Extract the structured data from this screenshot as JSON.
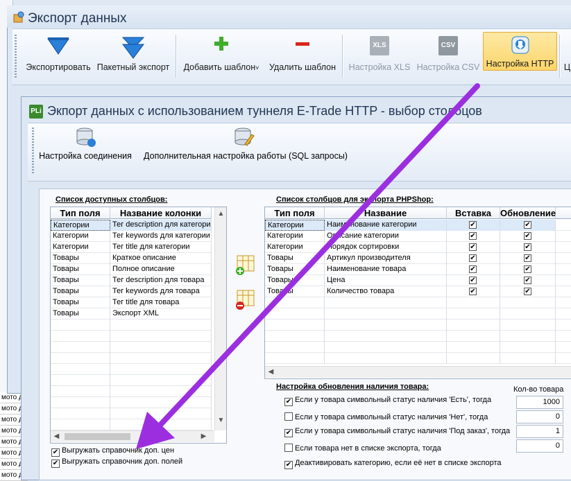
{
  "outer_window": {
    "title": "Экспорт данных"
  },
  "toolbar": {
    "export_label": "Экспортировать",
    "batch_export_label": "Пакетный экспорт",
    "add_template_label": "Добавить шаблон",
    "add_template_arrow": "˅",
    "delete_template_label": "Удалить шаблон",
    "xls_settings_label": "Настройка XLS",
    "xls_icon_text": "XLS",
    "csv_settings_label": "Настройка CSV",
    "csv_icon_text": "CSV",
    "http_settings_label": "Настройка HTTP",
    "cut_label": "Ц"
  },
  "background": {
    "moto_rows": [
      "мото д",
      "мото д",
      "мото д",
      "мото д",
      "мото д",
      "мото д",
      "мото д",
      "мото д"
    ]
  },
  "dialog": {
    "title": "Экпорт данных с использованием туннеля E-Trade HTTP - выбор столбцов",
    "icon_text": "PLi",
    "connection_settings_label": "Настройка соединения",
    "extra_settings_label": "Дополнительная настройка работы (SQL запросы)"
  },
  "available": {
    "caption": "Список доступных столбцов:",
    "headers": [
      "Тип поля",
      "Название колонки"
    ],
    "rows": [
      [
        "Категории",
        "Тег description для категории"
      ],
      [
        "Категории",
        "Тег keywords для категории"
      ],
      [
        "Категории",
        "Тег title для категории"
      ],
      [
        "Товары",
        "Краткое описание"
      ],
      [
        "Товары",
        "Полное описание"
      ],
      [
        "Товары",
        "Тег description для товара"
      ],
      [
        "Товары",
        "Тег keywords для товара"
      ],
      [
        "Товары",
        "Тег title для товара"
      ],
      [
        "Товары",
        "Экспорт XML"
      ]
    ]
  },
  "export_cols": {
    "caption": "Список столбцов для экспорта PHPShop:",
    "headers": [
      "Тип поля",
      "Название",
      "Вставка",
      "Обновление"
    ],
    "rows": [
      [
        "Категории",
        "Наименование категории"
      ],
      [
        "Категории",
        "Описание категории"
      ],
      [
        "Категории",
        "Порядок сортировки"
      ],
      [
        "Товары",
        "Артикул производителя"
      ],
      [
        "Товары",
        "Наименование товара"
      ],
      [
        "Товары",
        "Цена"
      ],
      [
        "Товары",
        "Количество товара"
      ]
    ]
  },
  "stock": {
    "caption": "Настройка обновления наличия товара:",
    "qty_header": "Кол-во товара",
    "options": [
      {
        "label": "Если у товара символьный статус наличия 'Есть', тогда",
        "checked": true,
        "value": "1000"
      },
      {
        "label": "Если у товара символьный статус наличия 'Нет', тогда",
        "checked": false,
        "value": "0"
      },
      {
        "label": "Если у товара символьный статус наличия 'Под заказ', тогда",
        "checked": true,
        "value": "1"
      },
      {
        "label": "Если товара нет в списке экспорта, тогда",
        "checked": false,
        "value": "0"
      }
    ],
    "deactivate_label": "Деактивировать категорию, если её нет в списке экспорта"
  },
  "options": {
    "export_prices_label": "Выгружать справочник доп. цен",
    "export_fields_label": "Выгружать справочник доп. полей"
  },
  "colors": {
    "accent_arrow": "#9b2fe0",
    "selection": "#dbe9f8",
    "active_button": "#fbd56a"
  }
}
